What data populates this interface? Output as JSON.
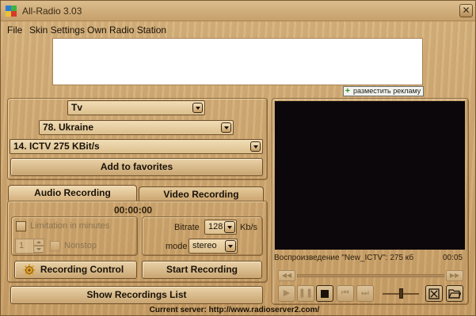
{
  "window": {
    "title": "All-Radio 3.03",
    "close_glyph": "✕"
  },
  "menu": {
    "items": [
      "File",
      "Skin Settings",
      "Own Radio Station"
    ]
  },
  "ad": {
    "link_label": "разместить рекламу",
    "plus_glyph": "+"
  },
  "selectors": {
    "category": "Tv",
    "country": "78. Ukraine",
    "station": "14. ICTV 275 KBit/s"
  },
  "buttons": {
    "add_favorites": "Add to favorites",
    "recording_control": "Recording Control",
    "start_recording": "Start Recording",
    "show_recordings": "Show Recordings List"
  },
  "tabs": {
    "audio": "Audio Recording",
    "video": "Video Recording"
  },
  "recording": {
    "timer": "00:00:00",
    "limitation_label": "Limitation in minutes",
    "minutes_value": "1",
    "nonstop_label": "Nonstop",
    "bitrate_label": "Bitrate",
    "bitrate_value": "128",
    "bitrate_unit": "Kb/s",
    "mode_label": "mode",
    "mode_value": "stereo"
  },
  "player": {
    "status": "Воспроизведение \"New_ICTV\": 275 кб",
    "time": "00:05",
    "volume_level": 0.5
  },
  "footer": {
    "current_server": "Current server: http://www.radioserver2.com/"
  },
  "colors": {
    "wood": "#cfa974",
    "border": "#6e4f2a",
    "video_bg": "#0c070b"
  },
  "icons": [
    "app-icon",
    "close-icon",
    "dropdown-arrow-icon",
    "gear-icon",
    "play-icon",
    "pause-icon",
    "stop-icon",
    "prev-icon",
    "next-icon",
    "fullscreen-icon",
    "folder-icon",
    "rewind-icon",
    "fast-forward-icon"
  ]
}
